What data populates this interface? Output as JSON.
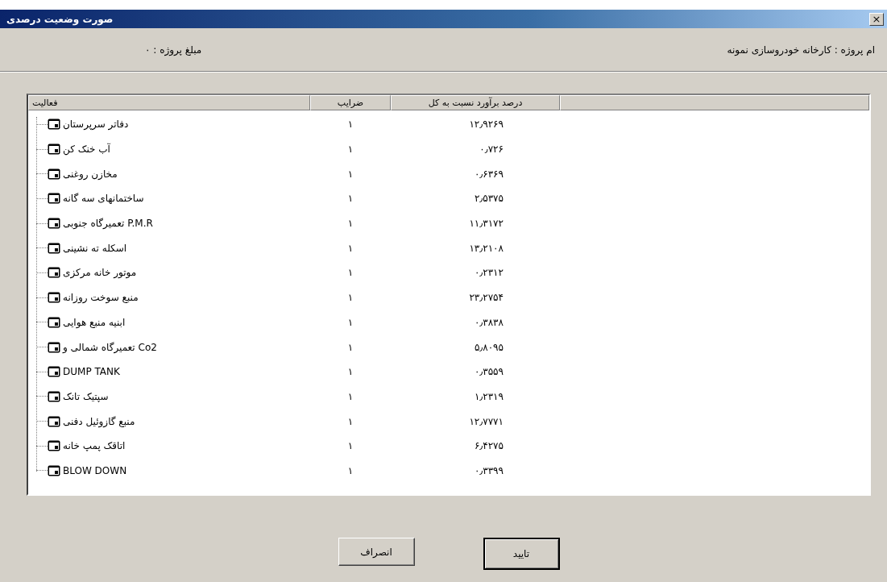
{
  "window": {
    "title": "صورت وضعیت درصدی",
    "close": "×"
  },
  "header": {
    "project_name": "ام پروژه : کارخانه خودروسازی نمونه",
    "project_amount": "مبلغ پروژه : ۰"
  },
  "table": {
    "columns": [
      "درصد برآورد نسبت به کل",
      "ضرایب",
      "فعالیت"
    ],
    "rows": [
      {
        "activity": "دفاتر سرپرستان",
        "factor": "۱",
        "percent": "۱۲٫۹۲۶۹"
      },
      {
        "activity": "آب خنک کن",
        "factor": "۱",
        "percent": "۰٫۷۲۶"
      },
      {
        "activity": "مخازن روغنی",
        "factor": "۱",
        "percent": "۰٫۶۳۶۹"
      },
      {
        "activity": "ساختمانهای سه گانه",
        "factor": "۱",
        "percent": "۲٫۵۳۷۵"
      },
      {
        "activity": "تعمیرگاه جنوبی P.M.R",
        "factor": "۱",
        "percent": "۱۱٫۳۱۷۲"
      },
      {
        "activity": "اسکله ته نشینی",
        "factor": "۱",
        "percent": "۱۳٫۲۱۰۸"
      },
      {
        "activity": "موتور خانه مرکزی",
        "factor": "۱",
        "percent": "۰٫۲۳۱۲"
      },
      {
        "activity": "منبع سوخت روزانه",
        "factor": "۱",
        "percent": "۲۳٫۲۷۵۴"
      },
      {
        "activity": "ابنیه منبع هوایی",
        "factor": "۱",
        "percent": "۰٫۳۸۳۸"
      },
      {
        "activity": "تعمیرگاه شمالی و Co2",
        "factor": "۱",
        "percent": "۵٫۸۰۹۵"
      },
      {
        "activity": "DUMP TANK",
        "factor": "۱",
        "percent": "۰٫۳۵۵۹"
      },
      {
        "activity": "سپتیک تانک",
        "factor": "۱",
        "percent": "۱٫۲۳۱۹"
      },
      {
        "activity": "منبع گازوئیل دفنی",
        "factor": "۱",
        "percent": "۱۲٫۷۷۷۱"
      },
      {
        "activity": "اتاقک پمپ خانه",
        "factor": "۱",
        "percent": "۶٫۴۲۷۵"
      },
      {
        "activity": "BLOW DOWN",
        "factor": "۱",
        "percent": "۰٫۳۳۹۹"
      }
    ]
  },
  "buttons": [
    {
      "label": "تایید",
      "default": true
    },
    {
      "label": "انصراف",
      "default": false
    }
  ]
}
